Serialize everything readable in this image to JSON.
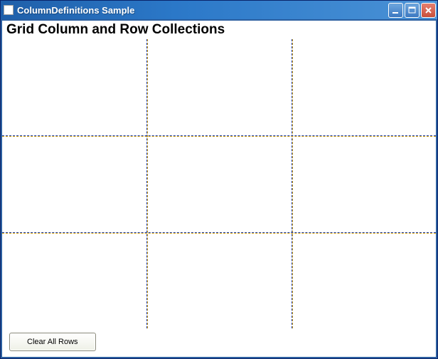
{
  "window": {
    "title": "ColumnDefinitions Sample"
  },
  "heading": "Grid Column and Row Collections",
  "buttons": {
    "clear_all_rows": "Clear All Rows"
  },
  "titlebar_icons": {
    "min": "minimize-icon",
    "max": "maximize-icon",
    "close": "close-icon"
  }
}
